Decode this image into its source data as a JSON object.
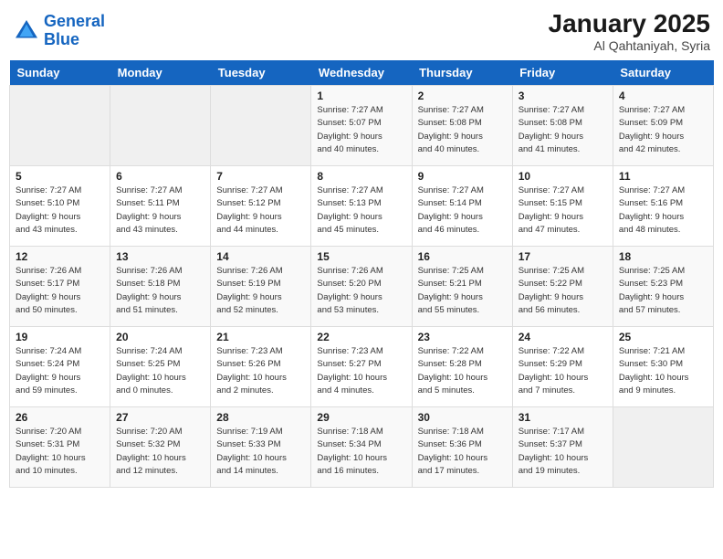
{
  "header": {
    "logo_line1": "General",
    "logo_line2": "Blue",
    "month": "January 2025",
    "location": "Al Qahtaniyah, Syria"
  },
  "weekdays": [
    "Sunday",
    "Monday",
    "Tuesday",
    "Wednesday",
    "Thursday",
    "Friday",
    "Saturday"
  ],
  "weeks": [
    [
      {
        "day": "",
        "info": ""
      },
      {
        "day": "",
        "info": ""
      },
      {
        "day": "",
        "info": ""
      },
      {
        "day": "1",
        "info": "Sunrise: 7:27 AM\nSunset: 5:07 PM\nDaylight: 9 hours\nand 40 minutes."
      },
      {
        "day": "2",
        "info": "Sunrise: 7:27 AM\nSunset: 5:08 PM\nDaylight: 9 hours\nand 40 minutes."
      },
      {
        "day": "3",
        "info": "Sunrise: 7:27 AM\nSunset: 5:08 PM\nDaylight: 9 hours\nand 41 minutes."
      },
      {
        "day": "4",
        "info": "Sunrise: 7:27 AM\nSunset: 5:09 PM\nDaylight: 9 hours\nand 42 minutes."
      }
    ],
    [
      {
        "day": "5",
        "info": "Sunrise: 7:27 AM\nSunset: 5:10 PM\nDaylight: 9 hours\nand 43 minutes."
      },
      {
        "day": "6",
        "info": "Sunrise: 7:27 AM\nSunset: 5:11 PM\nDaylight: 9 hours\nand 43 minutes."
      },
      {
        "day": "7",
        "info": "Sunrise: 7:27 AM\nSunset: 5:12 PM\nDaylight: 9 hours\nand 44 minutes."
      },
      {
        "day": "8",
        "info": "Sunrise: 7:27 AM\nSunset: 5:13 PM\nDaylight: 9 hours\nand 45 minutes."
      },
      {
        "day": "9",
        "info": "Sunrise: 7:27 AM\nSunset: 5:14 PM\nDaylight: 9 hours\nand 46 minutes."
      },
      {
        "day": "10",
        "info": "Sunrise: 7:27 AM\nSunset: 5:15 PM\nDaylight: 9 hours\nand 47 minutes."
      },
      {
        "day": "11",
        "info": "Sunrise: 7:27 AM\nSunset: 5:16 PM\nDaylight: 9 hours\nand 48 minutes."
      }
    ],
    [
      {
        "day": "12",
        "info": "Sunrise: 7:26 AM\nSunset: 5:17 PM\nDaylight: 9 hours\nand 50 minutes."
      },
      {
        "day": "13",
        "info": "Sunrise: 7:26 AM\nSunset: 5:18 PM\nDaylight: 9 hours\nand 51 minutes."
      },
      {
        "day": "14",
        "info": "Sunrise: 7:26 AM\nSunset: 5:19 PM\nDaylight: 9 hours\nand 52 minutes."
      },
      {
        "day": "15",
        "info": "Sunrise: 7:26 AM\nSunset: 5:20 PM\nDaylight: 9 hours\nand 53 minutes."
      },
      {
        "day": "16",
        "info": "Sunrise: 7:25 AM\nSunset: 5:21 PM\nDaylight: 9 hours\nand 55 minutes."
      },
      {
        "day": "17",
        "info": "Sunrise: 7:25 AM\nSunset: 5:22 PM\nDaylight: 9 hours\nand 56 minutes."
      },
      {
        "day": "18",
        "info": "Sunrise: 7:25 AM\nSunset: 5:23 PM\nDaylight: 9 hours\nand 57 minutes."
      }
    ],
    [
      {
        "day": "19",
        "info": "Sunrise: 7:24 AM\nSunset: 5:24 PM\nDaylight: 9 hours\nand 59 minutes."
      },
      {
        "day": "20",
        "info": "Sunrise: 7:24 AM\nSunset: 5:25 PM\nDaylight: 10 hours\nand 0 minutes."
      },
      {
        "day": "21",
        "info": "Sunrise: 7:23 AM\nSunset: 5:26 PM\nDaylight: 10 hours\nand 2 minutes."
      },
      {
        "day": "22",
        "info": "Sunrise: 7:23 AM\nSunset: 5:27 PM\nDaylight: 10 hours\nand 4 minutes."
      },
      {
        "day": "23",
        "info": "Sunrise: 7:22 AM\nSunset: 5:28 PM\nDaylight: 10 hours\nand 5 minutes."
      },
      {
        "day": "24",
        "info": "Sunrise: 7:22 AM\nSunset: 5:29 PM\nDaylight: 10 hours\nand 7 minutes."
      },
      {
        "day": "25",
        "info": "Sunrise: 7:21 AM\nSunset: 5:30 PM\nDaylight: 10 hours\nand 9 minutes."
      }
    ],
    [
      {
        "day": "26",
        "info": "Sunrise: 7:20 AM\nSunset: 5:31 PM\nDaylight: 10 hours\nand 10 minutes."
      },
      {
        "day": "27",
        "info": "Sunrise: 7:20 AM\nSunset: 5:32 PM\nDaylight: 10 hours\nand 12 minutes."
      },
      {
        "day": "28",
        "info": "Sunrise: 7:19 AM\nSunset: 5:33 PM\nDaylight: 10 hours\nand 14 minutes."
      },
      {
        "day": "29",
        "info": "Sunrise: 7:18 AM\nSunset: 5:34 PM\nDaylight: 10 hours\nand 16 minutes."
      },
      {
        "day": "30",
        "info": "Sunrise: 7:18 AM\nSunset: 5:36 PM\nDaylight: 10 hours\nand 17 minutes."
      },
      {
        "day": "31",
        "info": "Sunrise: 7:17 AM\nSunset: 5:37 PM\nDaylight: 10 hours\nand 19 minutes."
      },
      {
        "day": "",
        "info": ""
      }
    ]
  ]
}
